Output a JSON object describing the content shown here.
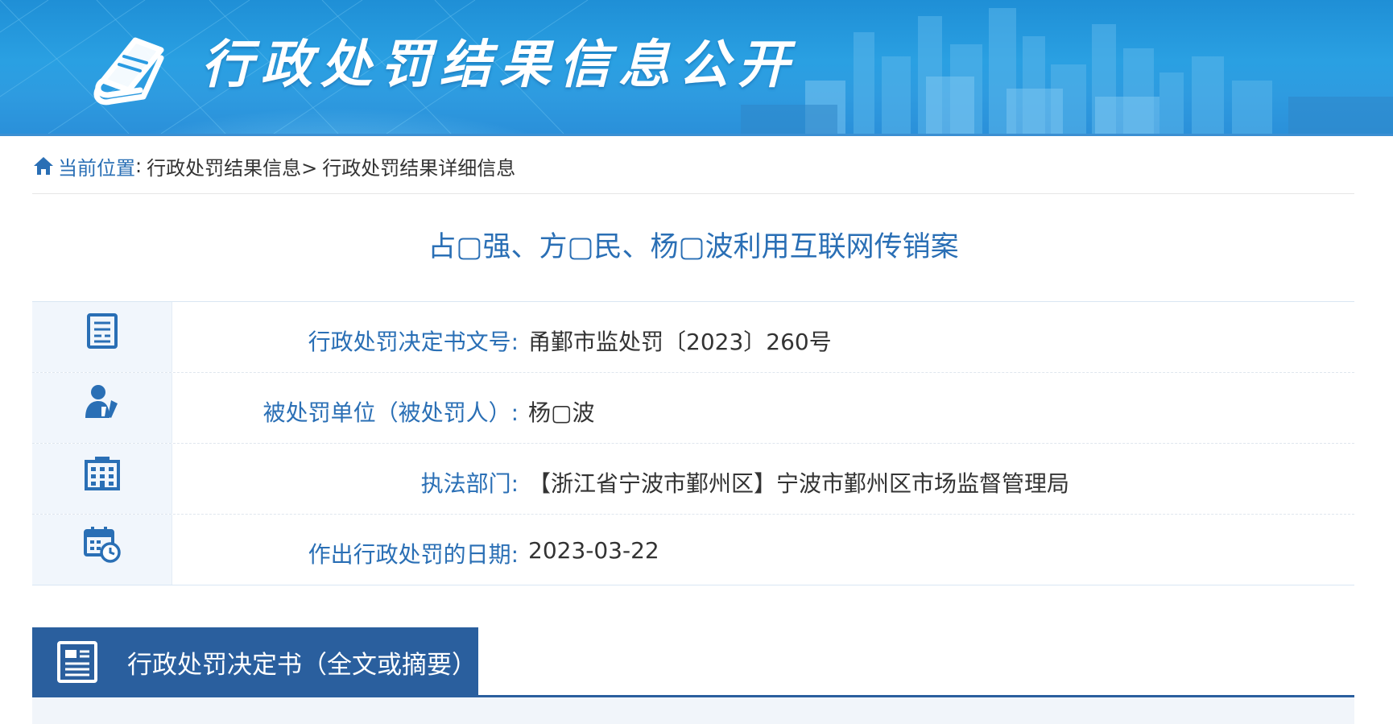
{
  "banner": {
    "title": "行政处罚结果信息公开",
    "logo_icon": "book-icon"
  },
  "breadcrumb": {
    "icon": "home-icon",
    "label": "当前位置",
    "separator": ":",
    "items": [
      "行政处罚结果信息>",
      "行政处罚结果详细信息"
    ]
  },
  "case": {
    "title": "占▢强、方▢民、杨▢波利用互联网传销案"
  },
  "info": {
    "rows": [
      {
        "icon": "document-list-icon",
        "label": "行政处罚决定书文号:",
        "value": "甬鄞市监处罚〔2023〕260号"
      },
      {
        "icon": "person-pen-icon",
        "label": "被处罚单位（被处罚人）:",
        "value": "杨▢波"
      },
      {
        "icon": "building-icon",
        "label": "执法部门:",
        "value": "【浙江省宁波市鄞州区】宁波市鄞州区市场监督管理局"
      },
      {
        "icon": "calendar-clock-icon",
        "label": "作出行政处罚的日期:",
        "value": "2023-03-22"
      }
    ]
  },
  "decision": {
    "icon": "document-icon",
    "title": "行政处罚决定书（全文或摘要）"
  },
  "colors": {
    "banner": "#2aa0e2",
    "accent_blue": "#2a6fb5",
    "section_blue": "#2a5f9e"
  }
}
